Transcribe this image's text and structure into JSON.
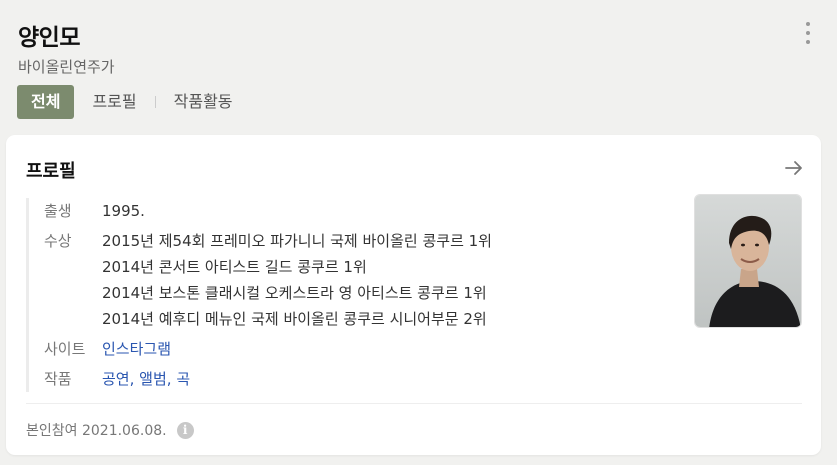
{
  "header": {
    "name": "양인모",
    "subtitle": "바이올린연주가"
  },
  "tabs": [
    {
      "label": "전체",
      "active": true
    },
    {
      "label": "프로필",
      "active": false
    },
    {
      "label": "작품활동",
      "active": false
    }
  ],
  "profile": {
    "title": "프로필",
    "birth_label": "출생",
    "birth_value": "1995.",
    "awards_label": "수상",
    "awards": [
      "2015년 제54회 프레미오 파가니니 국제 바이올린 콩쿠르 1위",
      "2014년 콘서트 아티스트 길드 콩쿠르 1위",
      "2014년 보스톤 클래시컬 오케스트라 영 아티스트 콩쿠르 1위",
      "2014년 예후디 메뉴인 국제 바이올린 콩쿠르 시니어부문 2위"
    ],
    "site_label": "사이트",
    "site_link": "인스타그램",
    "works_label": "작품",
    "works_links": [
      "공연",
      "앨범",
      "곡"
    ],
    "works_separator": ", "
  },
  "footer": {
    "text": "본인참여 2021.06.08.",
    "info_glyph": "i"
  },
  "colors": {
    "accent": "#7c8b6e",
    "link": "#2a56b0",
    "background": "#f1f1ef"
  },
  "icons": {
    "more": "more-vertical-icon",
    "arrow": "arrow-right-icon",
    "info": "info-icon"
  }
}
